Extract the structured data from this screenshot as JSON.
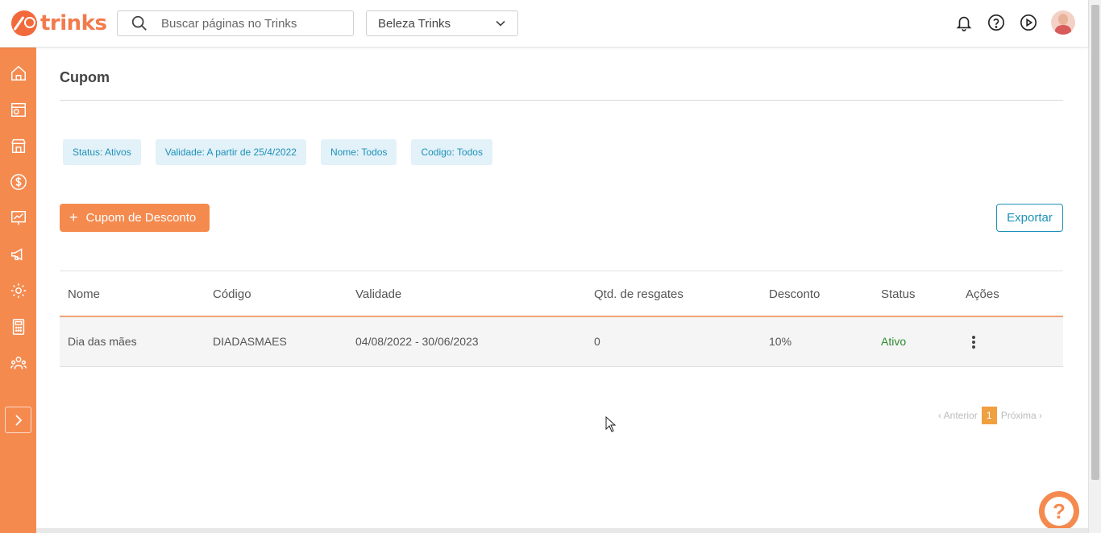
{
  "app": {
    "logo_text": "trinks"
  },
  "search": {
    "placeholder": "Buscar páginas no Trinks"
  },
  "store_select": {
    "value": "Beleza Trinks"
  },
  "header_icons": [
    "bell-icon",
    "help-circle-icon",
    "play-circle-icon",
    "avatar"
  ],
  "sidebar": {
    "items": [
      "home-icon",
      "schedule-icon",
      "store-icon",
      "dollar-icon",
      "chart-icon",
      "megaphone-icon",
      "settings-icon",
      "calculator-icon",
      "people-icon"
    ]
  },
  "page": {
    "title": "Cupom"
  },
  "filters": [
    "Status: Ativos",
    "Validade: A partir de 25/4/2022",
    "Nome: Todos",
    "Codigo: Todos"
  ],
  "actions": {
    "add_label": "Cupom de Desconto",
    "export_label": "Exportar"
  },
  "table": {
    "headers": [
      "Nome",
      "Código",
      "Validade",
      "Qtd. de resgates",
      "Desconto",
      "Status",
      "Ações"
    ],
    "rows": [
      {
        "nome": "Dia das mães",
        "codigo": "DIADASMAES",
        "validade": "04/08/2022 - 30/06/2023",
        "qtd": "0",
        "desconto": "10%",
        "status": "Ativo"
      }
    ]
  },
  "pagination": {
    "prev": "‹ Anterior",
    "current": "1",
    "next": "Próxima ›"
  },
  "colors": {
    "accent": "#f58a4f",
    "link": "#1d92b8",
    "status_active": "#2e8b2e"
  }
}
